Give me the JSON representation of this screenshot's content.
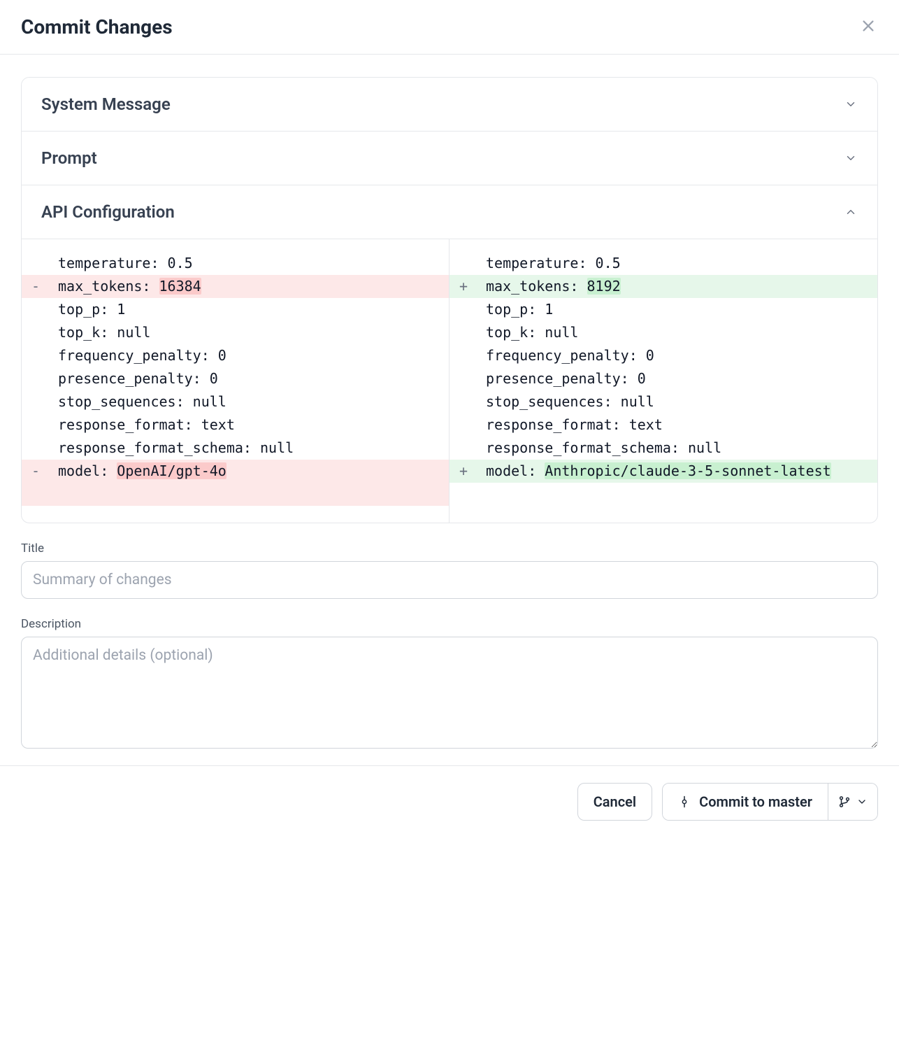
{
  "dialog": {
    "title": "Commit Changes"
  },
  "sections": {
    "system_message": {
      "title": "System Message",
      "expanded": false
    },
    "prompt": {
      "title": "Prompt",
      "expanded": false
    },
    "api_config": {
      "title": "API Configuration",
      "expanded": true
    }
  },
  "diff": {
    "left": [
      {
        "type": "ctx",
        "sign": " ",
        "text": "temperature: 0.5"
      },
      {
        "type": "del",
        "sign": "-",
        "prefix": "max_tokens: ",
        "highlight": "16384",
        "suffix": ""
      },
      {
        "type": "ctx",
        "sign": " ",
        "text": "top_p: 1"
      },
      {
        "type": "ctx",
        "sign": " ",
        "text": "top_k: null"
      },
      {
        "type": "ctx",
        "sign": " ",
        "text": "frequency_penalty: 0"
      },
      {
        "type": "ctx",
        "sign": " ",
        "text": "presence_penalty: 0"
      },
      {
        "type": "ctx",
        "sign": " ",
        "text": "stop_sequences: null"
      },
      {
        "type": "ctx",
        "sign": " ",
        "text": "response_format: text"
      },
      {
        "type": "ctx",
        "sign": " ",
        "text": "response_format_schema: null"
      },
      {
        "type": "del",
        "sign": "-",
        "prefix": "model: ",
        "highlight": "OpenAI/gpt-4o",
        "suffix": ""
      },
      {
        "type": "del",
        "sign": " ",
        "prefix": "",
        "highlight": "",
        "suffix": ""
      }
    ],
    "right": [
      {
        "type": "ctx",
        "sign": " ",
        "text": "temperature: 0.5"
      },
      {
        "type": "add",
        "sign": "+",
        "prefix": "max_tokens: ",
        "highlight": "8192",
        "suffix": ""
      },
      {
        "type": "ctx",
        "sign": " ",
        "text": "top_p: 1"
      },
      {
        "type": "ctx",
        "sign": " ",
        "text": "top_k: null"
      },
      {
        "type": "ctx",
        "sign": " ",
        "text": "frequency_penalty: 0"
      },
      {
        "type": "ctx",
        "sign": " ",
        "text": "presence_penalty: 0"
      },
      {
        "type": "ctx",
        "sign": " ",
        "text": "stop_sequences: null"
      },
      {
        "type": "ctx",
        "sign": " ",
        "text": "response_format: text"
      },
      {
        "type": "ctx",
        "sign": " ",
        "text": "response_format_schema: null"
      },
      {
        "type": "add",
        "sign": "+",
        "prefix": "model: ",
        "highlight": "Anthropic/claude-3-5-sonnet-latest",
        "suffix": ""
      }
    ]
  },
  "form": {
    "title_label": "Title",
    "title_placeholder": "Summary of changes",
    "title_value": "",
    "description_label": "Description",
    "description_placeholder": "Additional details (optional)",
    "description_value": ""
  },
  "footer": {
    "cancel_label": "Cancel",
    "commit_label": "Commit to master"
  }
}
